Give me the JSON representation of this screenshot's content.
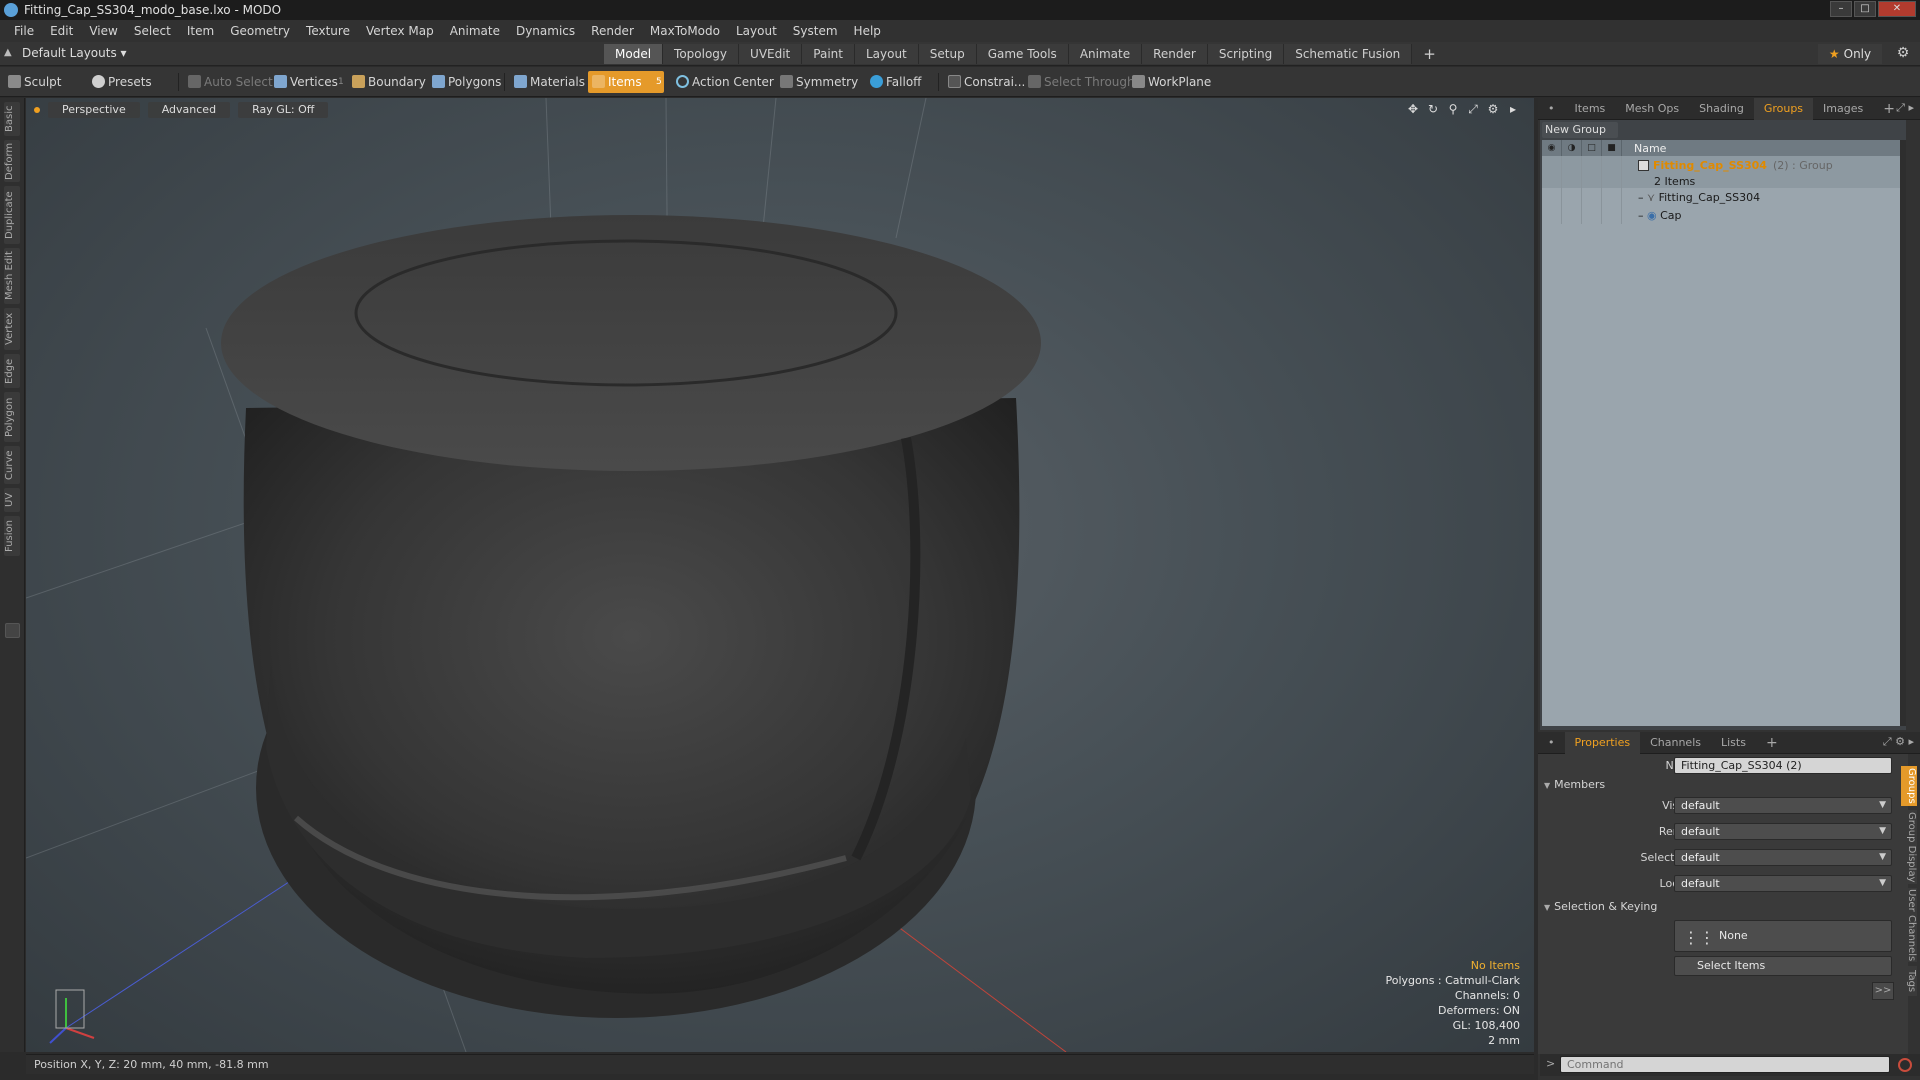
{
  "window": {
    "title": "Fitting_Cap_SS304_modo_base.lxo - MODO"
  },
  "menu": [
    "File",
    "Edit",
    "View",
    "Select",
    "Item",
    "Geometry",
    "Texture",
    "Vertex Map",
    "Animate",
    "Dynamics",
    "Render",
    "MaxToModo",
    "Layout",
    "System",
    "Help"
  ],
  "layout_bar": {
    "layouts_dropdown": "Default Layouts ▾",
    "tabs": [
      "Model",
      "Topology",
      "UVEdit",
      "Paint",
      "Layout",
      "Setup",
      "Game Tools",
      "Animate",
      "Render",
      "Scripting",
      "Schematic Fusion"
    ],
    "active_tab": "Model",
    "plus": "+",
    "only_label": "Only"
  },
  "toolbar": {
    "sculpt": "Sculpt",
    "presets": "Presets",
    "auto_select": "Auto Select",
    "vertices": "Vertices",
    "vertices_count": "1",
    "boundary": "Boundary",
    "polygons": "Polygons",
    "materials": "Materials",
    "items": "Items",
    "items_count": "5",
    "action_center": "Action Center",
    "symmetry": "Symmetry",
    "falloff": "Falloff",
    "constraints": "Constrai...",
    "select_through": "Select Through",
    "workplane": "WorkPlane"
  },
  "left_tabs": [
    "Basic",
    "Deform",
    "Duplicate",
    "Mesh Edit",
    "Vertex",
    "Edge",
    "Polygon",
    "Curve",
    "UV",
    "Fusion"
  ],
  "viewport": {
    "view": "Perspective",
    "shading": "Advanced",
    "raygl": "Ray GL: Off",
    "info": {
      "selection": "No Items",
      "polygons": "Polygons : Catmull-Clark",
      "channels": "Channels: 0",
      "deformers": "Deformers: ON",
      "gl": "GL: 108,400",
      "scale": "2 mm"
    }
  },
  "status": {
    "position": "Position X, Y, Z:  20 mm, 40 mm, -81.8 mm"
  },
  "right_panel": {
    "tabs": [
      "Items",
      "Mesh Ops",
      "Shading",
      "Groups",
      "Images"
    ],
    "active_tab": "Groups",
    "new_group": "New Group",
    "list_header": "Name",
    "group": {
      "name": "Fitting_Cap_SS304",
      "suffix": "(2) : Group",
      "count": "2 Items"
    },
    "members": [
      "Fitting_Cap_SS304",
      "Cap"
    ]
  },
  "properties": {
    "tabs": [
      "Properties",
      "Channels",
      "Lists"
    ],
    "active_tab": "Properties",
    "name_label": "Name",
    "name_value": "Fitting_Cap_SS304 (2)",
    "members_section": "Members",
    "visible_label": "Visible",
    "visible_value": "default",
    "render_label": "Render",
    "render_value": "default",
    "selectable_label": "Selectable",
    "selectable_value": "default",
    "locked_label": "Locked",
    "locked_value": "default",
    "selkey_section": "Selection & Keying",
    "none_btn": "None",
    "select_items_btn": "Select Items",
    "more": ">>",
    "side_tabs": [
      "Groups",
      "Group Display",
      "User Channels",
      "Tags"
    ]
  },
  "command": {
    "placeholder": "Command",
    "prompt": ">"
  },
  "colors": {
    "accent": "#e59a2a",
    "group_name": "#e08a00"
  }
}
